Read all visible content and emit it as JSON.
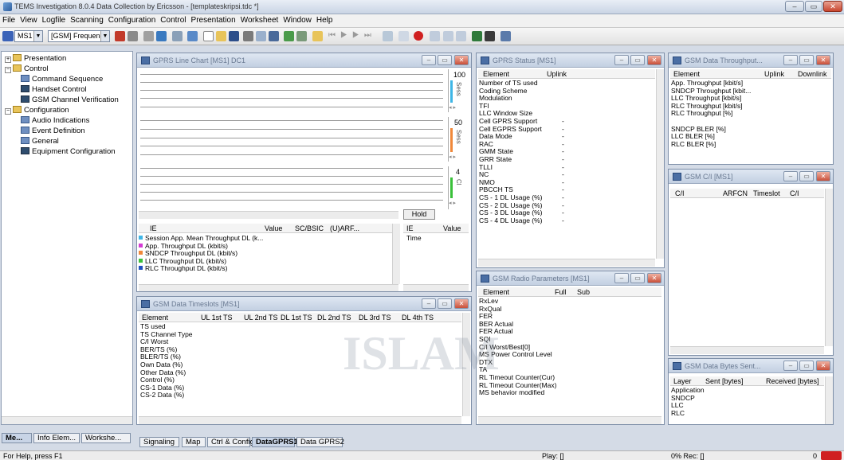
{
  "window_title": "TEMS Investigation 8.0.4 Data Collection by Ericsson - [templateskripsi.tdc *]",
  "menu": [
    "File",
    "View",
    "Logfile",
    "Scanning",
    "Configuration",
    "Control",
    "Presentation",
    "Worksheet",
    "Window",
    "Help"
  ],
  "toolbar": {
    "ms_combo": "MS1",
    "scan_combo": "[GSM] Frequency Scanning"
  },
  "tree": {
    "presentation": "Presentation",
    "control": "Control",
    "command_sequence": "Command Sequence",
    "handset_control": "Handset Control",
    "gsm_channel_verification": "GSM Channel Verification",
    "configuration": "Configuration",
    "audio_indications": "Audio Indications",
    "event_definition": "Event Definition",
    "general": "General",
    "equipment_configuration": "Equipment Configuration"
  },
  "left_tabs": [
    "Me...",
    "Info Elem...",
    "Workshe..."
  ],
  "line_chart": {
    "title": "GPRS Line Chart [MS1] DC1",
    "axis1": {
      "value": "100",
      "label": "Sess"
    },
    "axis2": {
      "value": "50",
      "label": "Sess"
    },
    "axis3": {
      "value": "4",
      "label": "Cl"
    },
    "hold": "Hold",
    "legend_headers": [
      "IE",
      "Value",
      "SC/BSIC",
      "(U)ARF..."
    ],
    "legend_items": [
      {
        "text": "Session App. Mean Throughput DL (k...",
        "color": "#3fb6e6"
      },
      {
        "text": "App. Throughput DL (kbit/s)",
        "color": "#d43bd4"
      },
      {
        "text": "SNDCP Throughput DL (kbit/s)",
        "color": "#f0883a"
      },
      {
        "text": "LLC Throughput DL (kbit/s)",
        "color": "#3ac03a"
      },
      {
        "text": "RLC Throughput DL (kbit/s)",
        "color": "#2050c0"
      }
    ],
    "right_headers": [
      "IE",
      "Value"
    ],
    "right_rows": [
      "Time"
    ]
  },
  "timeslots": {
    "title": "GSM Data Timeslots [MS1]",
    "headers": [
      "Element",
      "UL 1st TS",
      "UL 2nd TS",
      "DL 1st TS",
      "DL 2nd TS",
      "DL 3rd TS",
      "DL 4th TS"
    ],
    "rows": [
      "TS used",
      "TS Channel Type",
      "C/I Worst",
      "BER/TS (%)",
      "BLER/TS (%)",
      "Own Data (%)",
      "Other Data (%)",
      "Control (%)",
      "CS-1 Data (%)",
      "CS-2 Data (%)"
    ]
  },
  "gprs_status": {
    "title": "GPRS Status [MS1]",
    "headers": [
      "Element",
      "Uplink"
    ],
    "rows": [
      "Number of TS used",
      "Coding Scheme",
      "Modulation",
      "TFI",
      "LLC Window Size",
      "Cell GPRS Support",
      "Cell EGPRS Support",
      "Data Mode",
      "RAC",
      "GMM State",
      "GRR State",
      "TLLI",
      "NC",
      "NMO",
      "PBCCH TS",
      "CS - 1 DL Usage (%)",
      "CS - 2 DL Usage (%)",
      "CS - 3 DL Usage (%)",
      "CS - 4 DL Usage (%)"
    ],
    "uplink_vals": [
      "",
      "",
      "",
      "",
      "",
      "-",
      "-",
      "-",
      "-",
      "-",
      "-",
      "-",
      "-",
      "-",
      "-",
      "-",
      "-",
      "-",
      "-"
    ]
  },
  "radio_params": {
    "title": "GSM Radio Parameters [MS1]",
    "headers": [
      "Element",
      "Full",
      "Sub"
    ],
    "rows": [
      "RxLev",
      "RxQual",
      "FER",
      "BER Actual",
      "FER Actual",
      "SQI",
      "C/I Worst/Best[0]",
      "MS Power Control Level",
      "DTX",
      "TA",
      "RL Timeout Counter(Cur)",
      "RL Timeout Counter(Max)",
      "MS behavior modified"
    ]
  },
  "throughput": {
    "title": "GSM Data Throughput...",
    "headers": [
      "Element",
      "Uplink",
      "Downlink"
    ],
    "rows": [
      "App. Throughput [kbit/s]",
      "SNDCP Throughput [kbit...",
      "LLC Throughput [kbit/s]",
      "RLC Throughput [kbit/s]",
      "RLC Throughput [%]",
      "",
      "SNDCP BLER [%]",
      "LLC BLER [%]",
      "RLC BLER [%]"
    ]
  },
  "ci": {
    "title": "GSM C/I [MS1]",
    "headers": [
      "C/I",
      "ARFCN",
      "Timeslot",
      "C/I"
    ]
  },
  "bytes_sent": {
    "title": "GSM Data Bytes Sent...",
    "headers": [
      "Layer",
      "Sent [bytes]",
      "Received [bytes]"
    ],
    "rows": [
      "Application",
      "SNDCP",
      "LLC",
      "RLC"
    ]
  },
  "bottom_tabs": [
    "Signaling",
    "Map",
    "Ctrl & Config",
    "DataGPRS1",
    "Data GPRS2"
  ],
  "status": {
    "help": "For Help, press F1",
    "play": "Play: []",
    "rec": "0% Rec: []",
    "count": "0"
  },
  "watermark": "ISLAM"
}
